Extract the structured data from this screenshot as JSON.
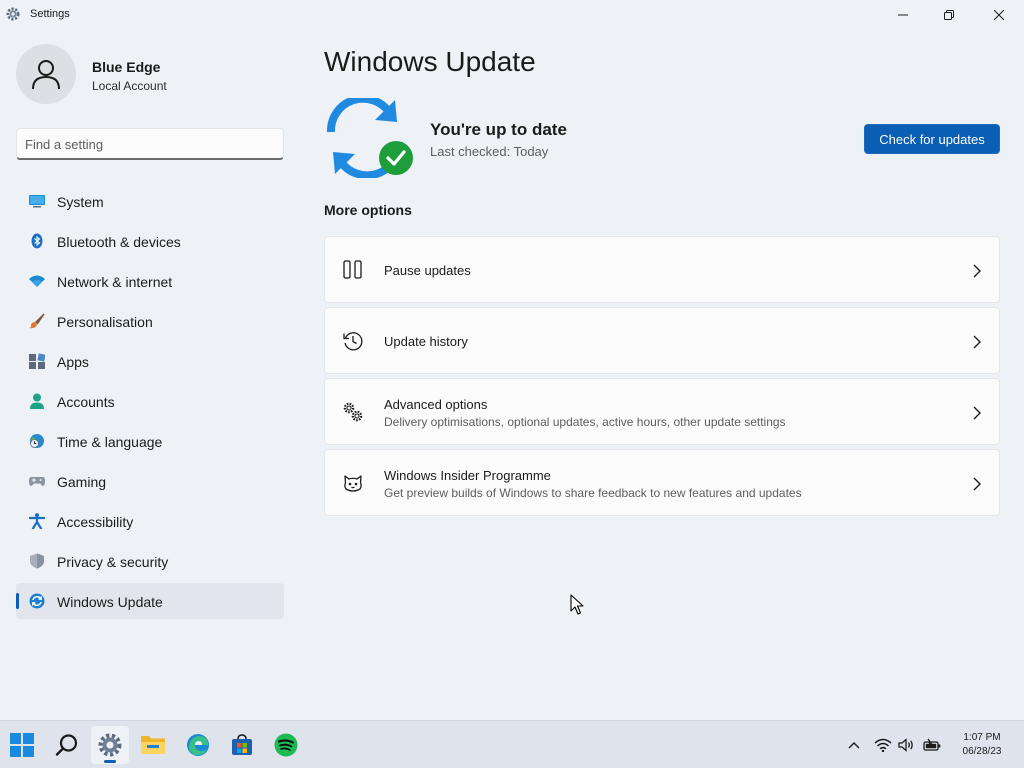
{
  "window": {
    "title": "Settings",
    "min_icon": "minimize-icon",
    "max_icon": "restore-icon",
    "close_icon": "close-icon"
  },
  "user": {
    "name": "Blue Edge",
    "account_type": "Local Account"
  },
  "search": {
    "placeholder": "Find a setting",
    "value": ""
  },
  "sidebar": {
    "items": [
      {
        "label": "System",
        "icon": "system-icon"
      },
      {
        "label": "Bluetooth & devices",
        "icon": "bluetooth-icon"
      },
      {
        "label": "Network & internet",
        "icon": "wifi-icon"
      },
      {
        "label": "Personalisation",
        "icon": "brush-icon"
      },
      {
        "label": "Apps",
        "icon": "apps-icon"
      },
      {
        "label": "Accounts",
        "icon": "accounts-icon"
      },
      {
        "label": "Time & language",
        "icon": "globe-clock-icon"
      },
      {
        "label": "Gaming",
        "icon": "gamepad-icon"
      },
      {
        "label": "Accessibility",
        "icon": "accessibility-icon"
      },
      {
        "label": "Privacy & security",
        "icon": "shield-icon"
      },
      {
        "label": "Windows Update",
        "icon": "windows-update-icon",
        "active": true
      }
    ]
  },
  "main": {
    "title": "Windows Update",
    "status_title": "You're up to date",
    "status_subtitle": "Last checked: Today",
    "check_button": "Check for updates",
    "more_options_title": "More options",
    "options": [
      {
        "title": "Pause updates",
        "subtitle": "",
        "icon": "pause-icon"
      },
      {
        "title": "Update history",
        "subtitle": "",
        "icon": "history-icon"
      },
      {
        "title": "Advanced options",
        "subtitle": "Delivery optimisations, optional updates, active hours, other update settings",
        "icon": "gears-icon"
      },
      {
        "title": "Windows Insider Programme",
        "subtitle": "Get preview builds of Windows to share feedback to new features and updates",
        "icon": "insider-cat-icon"
      }
    ]
  },
  "taskbar": {
    "apps": [
      "start-icon",
      "search-icon",
      "settings-icon",
      "file-explorer-icon",
      "edge-icon",
      "store-icon",
      "spotify-icon"
    ],
    "tray": [
      "chevron-up-icon",
      "wifi-icon",
      "volume-icon",
      "battery-icon"
    ],
    "time": "1:07 PM",
    "date": "06/28/23"
  },
  "colors": {
    "accent": "#0a5fb4",
    "background": "#eef1f6",
    "card": "#fbfbfc",
    "check_green": "#1e9e3a"
  }
}
